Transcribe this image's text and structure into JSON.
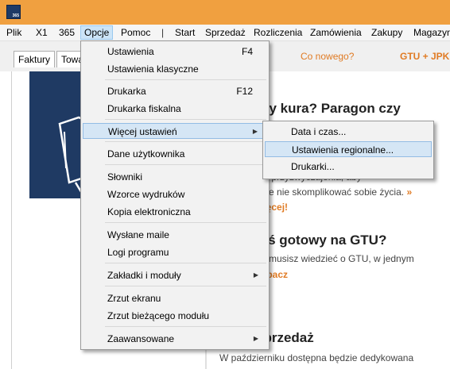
{
  "app": {
    "icon_text": "365"
  },
  "menubar": {
    "items": [
      "Plik",
      "X1",
      "365",
      "Opcje",
      "Pomoc",
      "|",
      "Start",
      "Sprzedaż",
      "Rozliczenia",
      "Zamówienia",
      "Zakupy",
      "Magazyn"
    ]
  },
  "tabs": [
    "Faktury",
    "Towa"
  ],
  "header_links": {
    "co_nowego": "Co nowego?",
    "gtu": "GTU + JPK"
  },
  "content": {
    "h1": "zy kura? Paragon czy",
    "p1a": "nie przyzwyczajenia, aby",
    "p1b": "onie nie skomplikować sobie życia.",
    "p1b_link": "»",
    "p1c": "więcej!",
    "h2": "teś gotowy na GTU?",
    "p2a": "co musisz wiedzieć o GTU, w jednym",
    "p2b": "zobacz",
    "h3": "sprzedaż",
    "p3": "W październiku dostępna będzie dedykowana"
  },
  "opcje_menu": {
    "items": [
      {
        "label": "Ustawienia",
        "shortcut": "F4"
      },
      {
        "label": "Ustawienia klasyczne"
      },
      {
        "label": "Drukarka",
        "shortcut": "F12"
      },
      {
        "label": "Drukarka fiskalna"
      },
      {
        "label": "Więcej ustawień",
        "submenu": true
      },
      {
        "label": "Dane użytkownika"
      },
      {
        "label": "Słowniki"
      },
      {
        "label": "Wzorce wydruków"
      },
      {
        "label": "Kopia elektroniczna"
      },
      {
        "label": "Wysłane maile"
      },
      {
        "label": "Logi programu"
      },
      {
        "label": "Zakładki i moduły",
        "submenu": true
      },
      {
        "label": "Zrzut ekranu"
      },
      {
        "label": "Zrzut bieżącego modułu"
      },
      {
        "label": "Zaawansowane",
        "submenu": true
      }
    ]
  },
  "submenu": {
    "items": [
      "Data i czas...",
      "Ustawienia regionalne...",
      "Drukarki..."
    ]
  },
  "colors": {
    "titlebar": "#F0A040",
    "accent_orange": "#E07B24",
    "menu_highlight": "#D5E6F5",
    "card_blue": "#1F3A63"
  }
}
